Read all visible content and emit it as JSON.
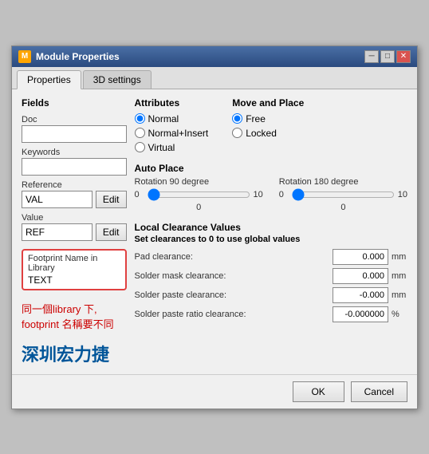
{
  "window": {
    "title": "Module Properties",
    "icon": "M"
  },
  "tabs": [
    {
      "label": "Properties",
      "active": true
    },
    {
      "label": "3D settings",
      "active": false
    }
  ],
  "left": {
    "fields_label": "Fields",
    "doc_label": "Doc",
    "doc_value": "",
    "keywords_label": "Keywords",
    "keywords_value": "",
    "reference_label": "Reference",
    "reference_value": "VAL",
    "edit_label_1": "Edit",
    "value_label": "Value",
    "value_value": "REF",
    "edit_label_2": "Edit",
    "footprint_label": "Footprint Name in Library",
    "footprint_value": "TEXT",
    "annotation_line1": "同一個library 下,",
    "annotation_line2": "footprint 名稱要不同",
    "shenzhen": "深圳宏力捷"
  },
  "right": {
    "attributes_label": "Attributes",
    "move_place_label": "Move and Place",
    "normal_label": "Normal",
    "normal_insert_label": "Normal+Insert",
    "virtual_label": "Virtual",
    "free_label": "Free",
    "locked_label": "Locked",
    "auto_place_label": "Auto Place",
    "rotation90_label": "Rotation 90 degree",
    "rotation180_label": "Rotation 180 degree",
    "slider_min": "0",
    "slider_max": "10",
    "slider_value1": "0",
    "slider_value2": "0",
    "clearance_section_label": "Local Clearance Values",
    "clearance_hint": "Set clearances to 0 to use global values",
    "pad_clearance_label": "Pad clearance:",
    "pad_clearance_value": "0.000",
    "pad_clearance_unit": "mm",
    "solder_mask_label": "Solder mask clearance:",
    "solder_mask_value": "0.000",
    "solder_mask_unit": "mm",
    "solder_paste_label": "Solder paste clearance:",
    "solder_paste_value": "-0.000",
    "solder_paste_unit": "mm",
    "solder_paste_ratio_label": "Solder paste ratio clearance:",
    "solder_paste_ratio_value": "-0.000000",
    "solder_paste_ratio_unit": "%"
  },
  "footer": {
    "ok_label": "OK",
    "cancel_label": "Cancel"
  }
}
